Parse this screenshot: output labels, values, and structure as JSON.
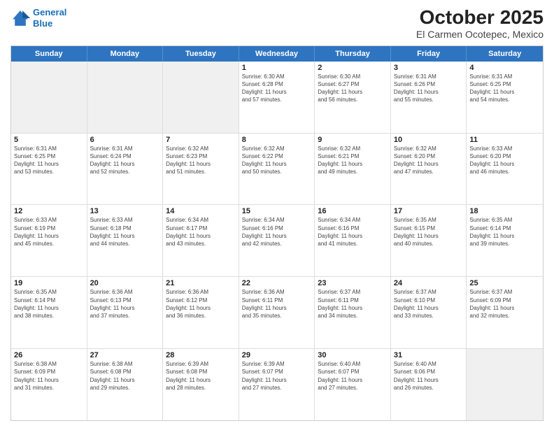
{
  "logo": {
    "line1": "General",
    "line2": "Blue"
  },
  "title": "October 2025",
  "subtitle": "El Carmen Ocotepec, Mexico",
  "days": [
    "Sunday",
    "Monday",
    "Tuesday",
    "Wednesday",
    "Thursday",
    "Friday",
    "Saturday"
  ],
  "rows": [
    [
      {
        "day": "",
        "content": ""
      },
      {
        "day": "",
        "content": ""
      },
      {
        "day": "",
        "content": ""
      },
      {
        "day": "1",
        "content": "Sunrise: 6:30 AM\nSunset: 6:28 PM\nDaylight: 11 hours\nand 57 minutes."
      },
      {
        "day": "2",
        "content": "Sunrise: 6:30 AM\nSunset: 6:27 PM\nDaylight: 11 hours\nand 56 minutes."
      },
      {
        "day": "3",
        "content": "Sunrise: 6:31 AM\nSunset: 6:26 PM\nDaylight: 11 hours\nand 55 minutes."
      },
      {
        "day": "4",
        "content": "Sunrise: 6:31 AM\nSunset: 6:25 PM\nDaylight: 11 hours\nand 54 minutes."
      }
    ],
    [
      {
        "day": "5",
        "content": "Sunrise: 6:31 AM\nSunset: 6:25 PM\nDaylight: 11 hours\nand 53 minutes."
      },
      {
        "day": "6",
        "content": "Sunrise: 6:31 AM\nSunset: 6:24 PM\nDaylight: 11 hours\nand 52 minutes."
      },
      {
        "day": "7",
        "content": "Sunrise: 6:32 AM\nSunset: 6:23 PM\nDaylight: 11 hours\nand 51 minutes."
      },
      {
        "day": "8",
        "content": "Sunrise: 6:32 AM\nSunset: 6:22 PM\nDaylight: 11 hours\nand 50 minutes."
      },
      {
        "day": "9",
        "content": "Sunrise: 6:32 AM\nSunset: 6:21 PM\nDaylight: 11 hours\nand 49 minutes."
      },
      {
        "day": "10",
        "content": "Sunrise: 6:32 AM\nSunset: 6:20 PM\nDaylight: 11 hours\nand 47 minutes."
      },
      {
        "day": "11",
        "content": "Sunrise: 6:33 AM\nSunset: 6:20 PM\nDaylight: 11 hours\nand 46 minutes."
      }
    ],
    [
      {
        "day": "12",
        "content": "Sunrise: 6:33 AM\nSunset: 6:19 PM\nDaylight: 11 hours\nand 45 minutes."
      },
      {
        "day": "13",
        "content": "Sunrise: 6:33 AM\nSunset: 6:18 PM\nDaylight: 11 hours\nand 44 minutes."
      },
      {
        "day": "14",
        "content": "Sunrise: 6:34 AM\nSunset: 6:17 PM\nDaylight: 11 hours\nand 43 minutes."
      },
      {
        "day": "15",
        "content": "Sunrise: 6:34 AM\nSunset: 6:16 PM\nDaylight: 11 hours\nand 42 minutes."
      },
      {
        "day": "16",
        "content": "Sunrise: 6:34 AM\nSunset: 6:16 PM\nDaylight: 11 hours\nand 41 minutes."
      },
      {
        "day": "17",
        "content": "Sunrise: 6:35 AM\nSunset: 6:15 PM\nDaylight: 11 hours\nand 40 minutes."
      },
      {
        "day": "18",
        "content": "Sunrise: 6:35 AM\nSunset: 6:14 PM\nDaylight: 11 hours\nand 39 minutes."
      }
    ],
    [
      {
        "day": "19",
        "content": "Sunrise: 6:35 AM\nSunset: 6:14 PM\nDaylight: 11 hours\nand 38 minutes."
      },
      {
        "day": "20",
        "content": "Sunrise: 6:36 AM\nSunset: 6:13 PM\nDaylight: 11 hours\nand 37 minutes."
      },
      {
        "day": "21",
        "content": "Sunrise: 6:36 AM\nSunset: 6:12 PM\nDaylight: 11 hours\nand 36 minutes."
      },
      {
        "day": "22",
        "content": "Sunrise: 6:36 AM\nSunset: 6:11 PM\nDaylight: 11 hours\nand 35 minutes."
      },
      {
        "day": "23",
        "content": "Sunrise: 6:37 AM\nSunset: 6:11 PM\nDaylight: 11 hours\nand 34 minutes."
      },
      {
        "day": "24",
        "content": "Sunrise: 6:37 AM\nSunset: 6:10 PM\nDaylight: 11 hours\nand 33 minutes."
      },
      {
        "day": "25",
        "content": "Sunrise: 6:37 AM\nSunset: 6:09 PM\nDaylight: 11 hours\nand 32 minutes."
      }
    ],
    [
      {
        "day": "26",
        "content": "Sunrise: 6:38 AM\nSunset: 6:09 PM\nDaylight: 11 hours\nand 31 minutes."
      },
      {
        "day": "27",
        "content": "Sunrise: 6:38 AM\nSunset: 6:08 PM\nDaylight: 11 hours\nand 29 minutes."
      },
      {
        "day": "28",
        "content": "Sunrise: 6:39 AM\nSunset: 6:08 PM\nDaylight: 11 hours\nand 28 minutes."
      },
      {
        "day": "29",
        "content": "Sunrise: 6:39 AM\nSunset: 6:07 PM\nDaylight: 11 hours\nand 27 minutes."
      },
      {
        "day": "30",
        "content": "Sunrise: 6:40 AM\nSunset: 6:07 PM\nDaylight: 11 hours\nand 27 minutes."
      },
      {
        "day": "31",
        "content": "Sunrise: 6:40 AM\nSunset: 6:06 PM\nDaylight: 11 hours\nand 26 minutes."
      },
      {
        "day": "",
        "content": ""
      }
    ]
  ]
}
